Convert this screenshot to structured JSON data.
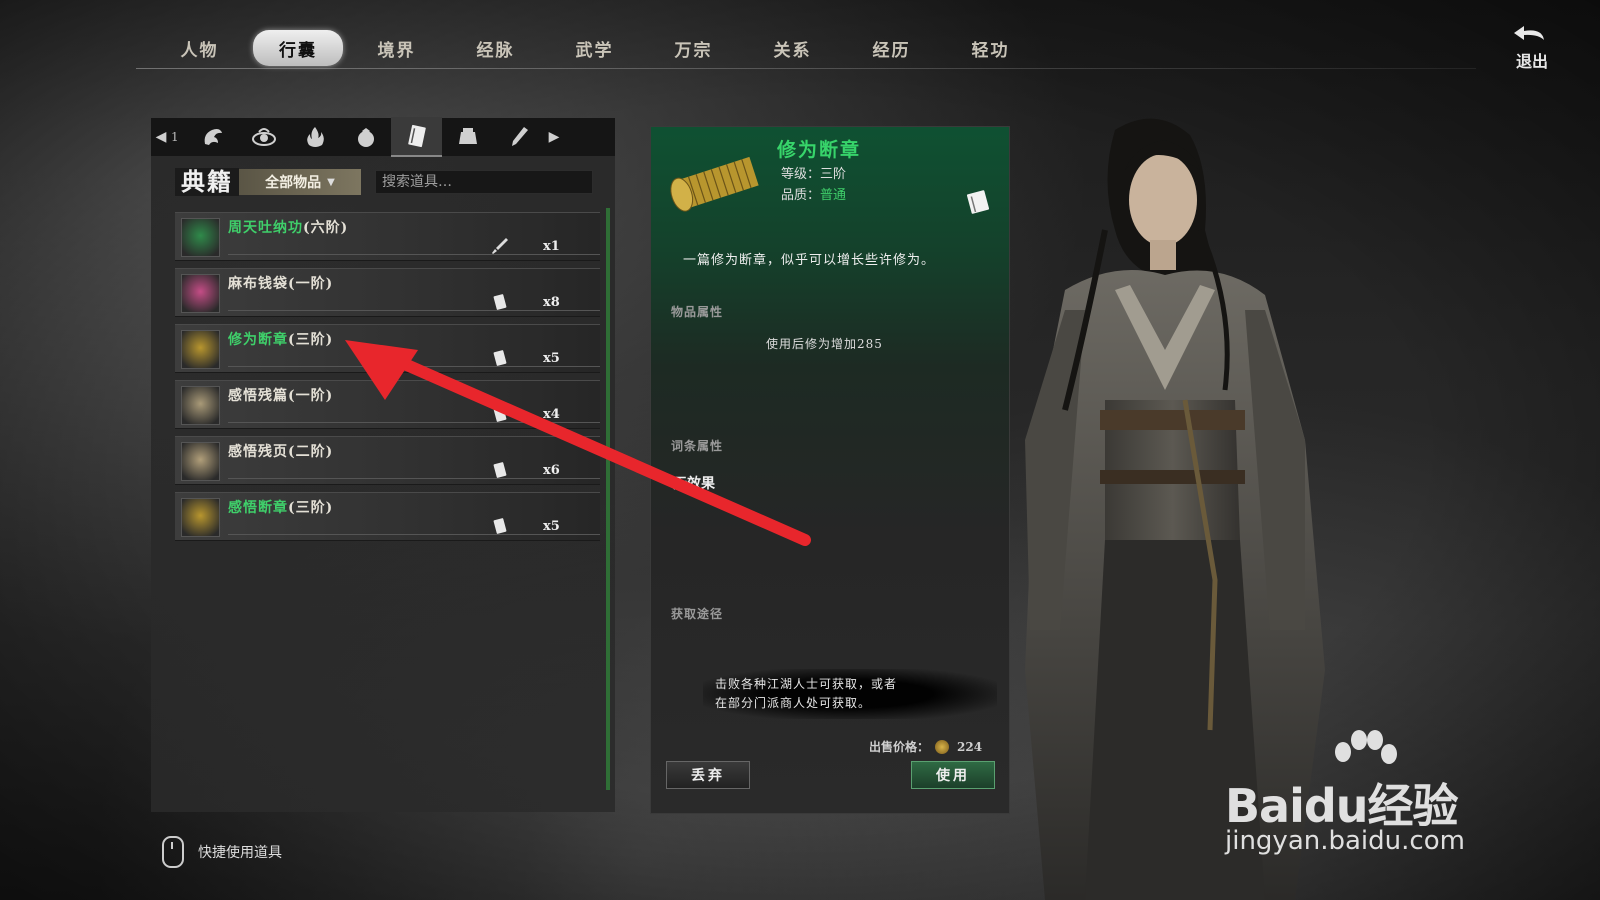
{
  "nav": {
    "tabs": [
      "人物",
      "行囊",
      "境界",
      "经脉",
      "武学",
      "万宗",
      "关系",
      "经历",
      "轻功"
    ],
    "active_index": 1,
    "exit_label": "退出"
  },
  "inventory": {
    "category_tab_count_label": "1",
    "category_icons": [
      "dragon-icon",
      "eye-swirl-icon",
      "flame-icon",
      "pouch-icon",
      "scroll-book-icon",
      "jar-icon",
      "brush-icon"
    ],
    "active_category": 4,
    "category_title": "典籍",
    "filter_label": "全部物品",
    "search_placeholder": "搜索道具…",
    "items": [
      {
        "name": "周天吐纳功",
        "tier": "(六阶)",
        "qty": "x1",
        "name_green": true,
        "icon_color": "#2f8a4a",
        "type_icon": "sword-icon"
      },
      {
        "name": "麻布钱袋",
        "tier": "(一阶)",
        "qty": "x8",
        "name_green": false,
        "icon_color": "#c44d86",
        "type_icon": "book-icon"
      },
      {
        "name": "修为断章",
        "tier": "(三阶)",
        "qty": "x5",
        "name_green": true,
        "icon_color": "#b8962e",
        "type_icon": "book-icon"
      },
      {
        "name": "感悟残篇",
        "tier": "(一阶)",
        "qty": "x4",
        "name_green": false,
        "icon_color": "#a99a78",
        "type_icon": "book-icon"
      },
      {
        "name": "感悟残页",
        "tier": "(二阶)",
        "qty": "x6",
        "name_green": false,
        "icon_color": "#b19f7a",
        "type_icon": "book-icon"
      },
      {
        "name": "感悟断章",
        "tier": "(三阶)",
        "qty": "x5",
        "name_green": true,
        "icon_color": "#b8962e",
        "type_icon": "book-icon"
      }
    ]
  },
  "detail": {
    "name": "修为断章",
    "level": "等级：三阶",
    "quality_label": "品质：",
    "quality_value": "普通",
    "description": "一篇修为断章，似乎可以增长些许修为。",
    "section_item_props": "物品属性",
    "item_prop": "使用后修为增加285",
    "section_entry_props": "词条属性",
    "entry_value": "无效果",
    "section_obtain": "获取途径",
    "obtain_text_1": "击败各种江湖人士可获取，或者",
    "obtain_text_2": "在部分门派商人处可获取。",
    "price_label": "出售价格：",
    "price_value": "224",
    "drop_button": "丢弃",
    "use_button": "使用"
  },
  "hint": {
    "label": "快捷使用道具"
  },
  "watermark": {
    "brand": "Baidu经验",
    "url": "jingyan.baidu.com"
  },
  "colors": {
    "accent_green": "#3fcf6a",
    "annotation_red": "#e8262c"
  }
}
